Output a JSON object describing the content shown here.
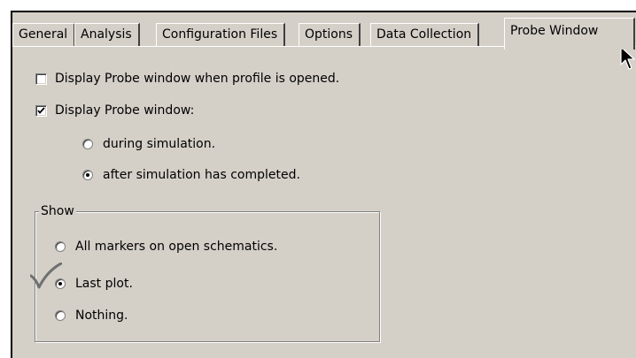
{
  "tabs": [
    {
      "label": "General",
      "active": false
    },
    {
      "label": "Analysis",
      "active": false
    },
    {
      "label": "Configuration Files",
      "active": false
    },
    {
      "label": "Options",
      "active": false
    },
    {
      "label": "Data Collection",
      "active": false
    },
    {
      "label": "Probe Window",
      "active": true
    }
  ],
  "options": {
    "display_on_open": {
      "label": "Display Probe window when profile is opened.",
      "checked": false
    },
    "display_probe": {
      "label": "Display Probe window:",
      "checked": true
    },
    "timing": {
      "during": {
        "label": "during simulation.",
        "selected": false
      },
      "after": {
        "label": "after simulation has completed.",
        "selected": true
      }
    }
  },
  "show_group": {
    "title": "Show",
    "items": [
      {
        "label": "All markers on open schematics.",
        "selected": false
      },
      {
        "label": "Last plot.",
        "selected": true
      },
      {
        "label": "Nothing.",
        "selected": false
      }
    ]
  },
  "icons": {
    "cursor": "mouse-pointer-icon",
    "annotation": "checkmark-icon"
  },
  "colors": {
    "dialog_bg": "#d4d0c8",
    "annotation": "#707070"
  }
}
